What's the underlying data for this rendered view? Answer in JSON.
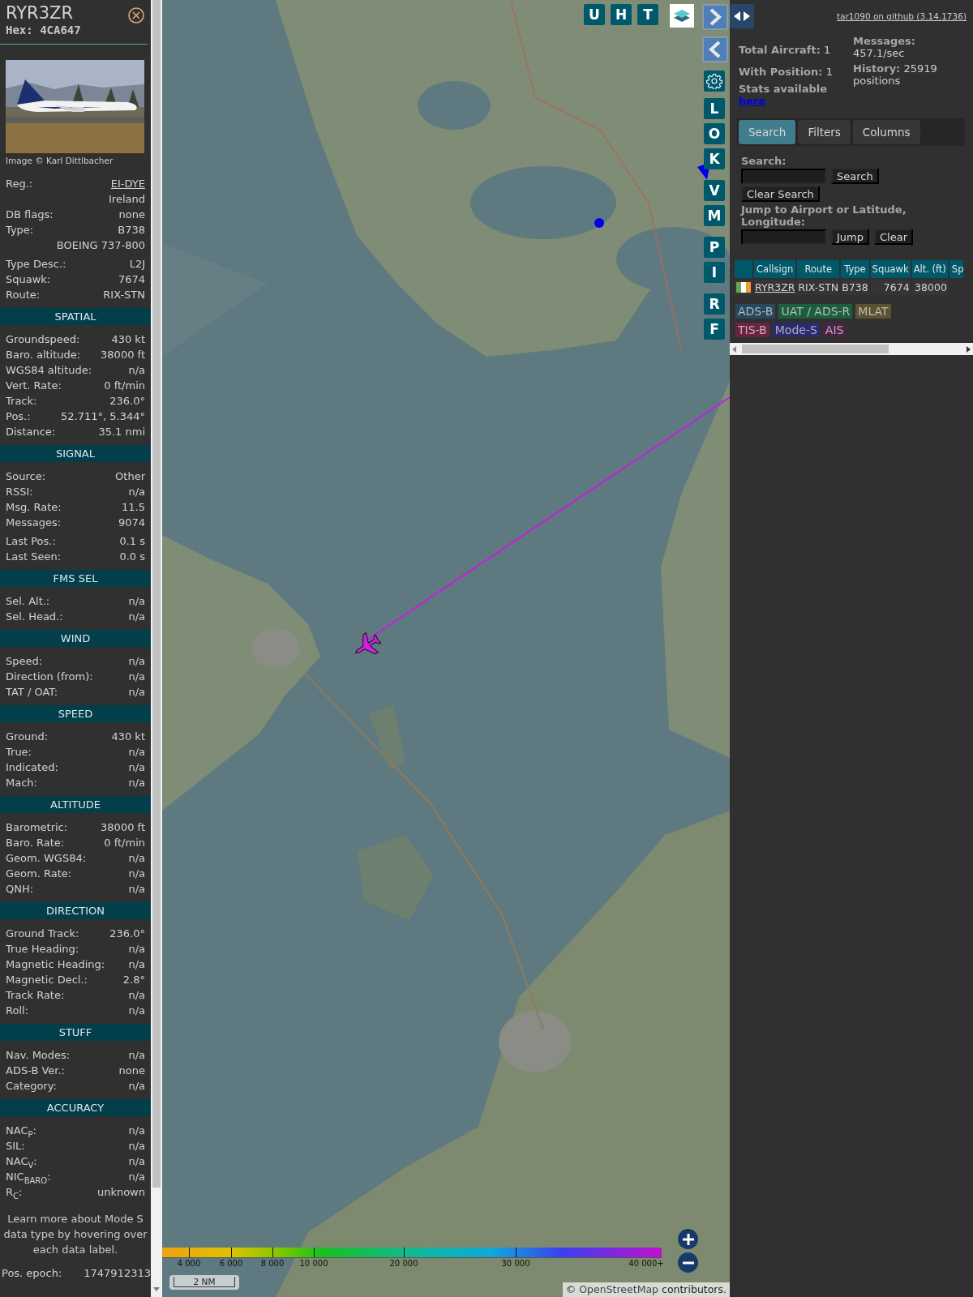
{
  "detail": {
    "callsign": "RYR3ZR",
    "hex": "Hex: 4CA647",
    "photo": {
      "kind": "picture",
      "credit": "Image © Karl Dittlbacher"
    },
    "info_groups": [
      [
        {
          "label": "Reg.:",
          "value": "EI-DYE",
          "link": true
        },
        {
          "value": "Ireland"
        },
        {
          "label": "DB flags:",
          "value": "none"
        },
        {
          "label": "Type:",
          "value": "B738"
        },
        {
          "value": "BOEING 737-800"
        }
      ],
      [
        {
          "label": "Type Desc.:",
          "value": "L2J"
        },
        {
          "label": "Squawk:",
          "value": "7674"
        },
        {
          "label": "Route:",
          "value": "RIX-STN"
        }
      ]
    ],
    "sections": [
      {
        "title": "SPATIAL",
        "groups": [
          [
            {
              "label": "Groundspeed:",
              "value": "430 kt"
            },
            {
              "label": "Baro. altitude:",
              "value": "38000 ft"
            },
            {
              "label": "WGS84 altitude:",
              "value": "n/a"
            },
            {
              "label": "Vert. Rate:",
              "value": "0 ft/min"
            },
            {
              "label": "Track:",
              "value": "236.0°"
            },
            {
              "label": "Pos.:",
              "value": "52.711°, 5.344°"
            },
            {
              "label": "Distance:",
              "value": "35.1 nmi"
            }
          ]
        ]
      },
      {
        "title": "SIGNAL",
        "groups": [
          [
            {
              "label": "Source:",
              "value": "Other"
            },
            {
              "label": "RSSI:",
              "value": "n/a"
            },
            {
              "label": "Msg. Rate:",
              "value": "11.5"
            },
            {
              "label": "Messages:",
              "value": "9074"
            }
          ],
          [
            {
              "label": "Last Pos.:",
              "value": "0.1 s"
            },
            {
              "label": "Last Seen:",
              "value": "0.0 s"
            }
          ]
        ]
      },
      {
        "title": "FMS SEL",
        "groups": [
          [
            {
              "label": "Sel. Alt.:",
              "value": "n/a"
            },
            {
              "label": "Sel. Head.:",
              "value": "n/a"
            }
          ]
        ]
      },
      {
        "title": "WIND",
        "groups": [
          [
            {
              "label": "Speed:",
              "value": "n/a"
            },
            {
              "label": "Direction (from):",
              "value": "n/a"
            },
            {
              "label": "TAT / OAT:",
              "value": "n/a"
            }
          ]
        ]
      },
      {
        "title": "SPEED",
        "groups": [
          [
            {
              "label": "Ground:",
              "value": "430 kt"
            },
            {
              "label": "True:",
              "value": "n/a"
            },
            {
              "label": "Indicated:",
              "value": "n/a"
            },
            {
              "label": "Mach:",
              "value": "n/a"
            }
          ]
        ]
      },
      {
        "title": "ALTITUDE",
        "groups": [
          [
            {
              "label": "Barometric:",
              "value": "38000 ft"
            },
            {
              "label": "Baro. Rate:",
              "value": "0 ft/min"
            },
            {
              "label": "Geom. WGS84:",
              "value": "n/a"
            },
            {
              "label": "Geom. Rate:",
              "value": "n/a"
            },
            {
              "label": "QNH:",
              "value": "n/a"
            }
          ]
        ]
      },
      {
        "title": "DIRECTION",
        "groups": [
          [
            {
              "label": "Ground Track:",
              "value": "236.0°"
            },
            {
              "label": "True Heading:",
              "value": "n/a"
            },
            {
              "label": "Magnetic Heading:",
              "value": "n/a"
            },
            {
              "label": "Magnetic Decl.:",
              "value": "2.8°"
            },
            {
              "label": "Track Rate:",
              "value": "n/a"
            },
            {
              "label": "Roll:",
              "value": "n/a"
            }
          ]
        ]
      },
      {
        "title": "STUFF",
        "groups": [
          [
            {
              "label": "Nav. Modes:",
              "value": "n/a"
            },
            {
              "label": "ADS-B Ver.:",
              "value": "none"
            },
            {
              "label": "Category:",
              "value": "n/a"
            }
          ]
        ]
      },
      {
        "title": "ACCURACY",
        "groups": [
          [
            {
              "label": "NAC$_{P}$:",
              "value": "n/a"
            },
            {
              "label": "SIL:",
              "value": "n/a"
            },
            {
              "label": "NAC$_{V}$:",
              "value": "n/a"
            },
            {
              "label": "NIC$_{BARO}$:",
              "value": "n/a"
            },
            {
              "label": "R$_{C}$:",
              "value": "unknown"
            }
          ]
        ]
      }
    ],
    "note": "Learn more about Mode S data type by hovering over each data label.",
    "epoch": {
      "label": "Pos. epoch:",
      "value": "1747912313"
    }
  },
  "map": {
    "top_buttons": [
      "U",
      "H",
      "T"
    ],
    "side_button_groups": [
      [
        "L",
        "O",
        "K"
      ],
      [
        "V",
        "M"
      ],
      [
        "P",
        "I"
      ],
      [
        "R",
        "F"
      ]
    ],
    "legend": [
      "4 000",
      "6 000",
      "8 000",
      "10 000",
      "20 000",
      "30 000",
      "40 000+"
    ],
    "scale": "2 NM",
    "attribution": {
      "prefix": "©",
      "link": "OpenStreetMap",
      "suffix": "contributors."
    }
  },
  "sidebar": {
    "github_link": "tar1090 on github (3.14.1736)",
    "stats_left": [
      {
        "label": "Total Aircraft:",
        "value": "1"
      },
      {
        "label": "With Position:",
        "value": "1"
      }
    ],
    "stats_right": [
      {
        "label": "Messages:",
        "value": "457.1/sec"
      },
      {
        "label": "History:",
        "value": "25919 positions"
      }
    ],
    "stats_note": {
      "label": "Stats available",
      "link": "here"
    },
    "tabs": [
      {
        "label": "Search",
        "selected": true
      },
      {
        "label": "Filters",
        "selected": false
      },
      {
        "label": "Columns",
        "selected": false
      }
    ],
    "search": {
      "label": "Search:",
      "button": "Search",
      "clear_button": "Clear Search",
      "jump_label": "Jump to Airport or Latitude, Longitude:",
      "jump_button": "Jump",
      "jump_clear_button": "Clear"
    },
    "table": {
      "columns": [
        "Callsign",
        "Route",
        "Type",
        "Squawk",
        "Alt. (ft)",
        "Sp"
      ],
      "rows": [
        {
          "cells": [
            "RYR3ZR",
            "RIX-STN",
            "B738",
            "7674",
            "38000"
          ]
        }
      ]
    },
    "badges": [
      {
        "label": "ADS-B",
        "color": "#26495c"
      },
      {
        "label": "UAT / ADS-R",
        "color": "#1d5e3e"
      },
      {
        "label": "MLAT",
        "color": "#5a5232"
      },
      {
        "label": "TIS-B",
        "color": "#6a2440"
      },
      {
        "label": "Mode-S",
        "color": "#2a2a6c"
      },
      {
        "label": "AIS",
        "color": "#4a2242"
      }
    ]
  }
}
